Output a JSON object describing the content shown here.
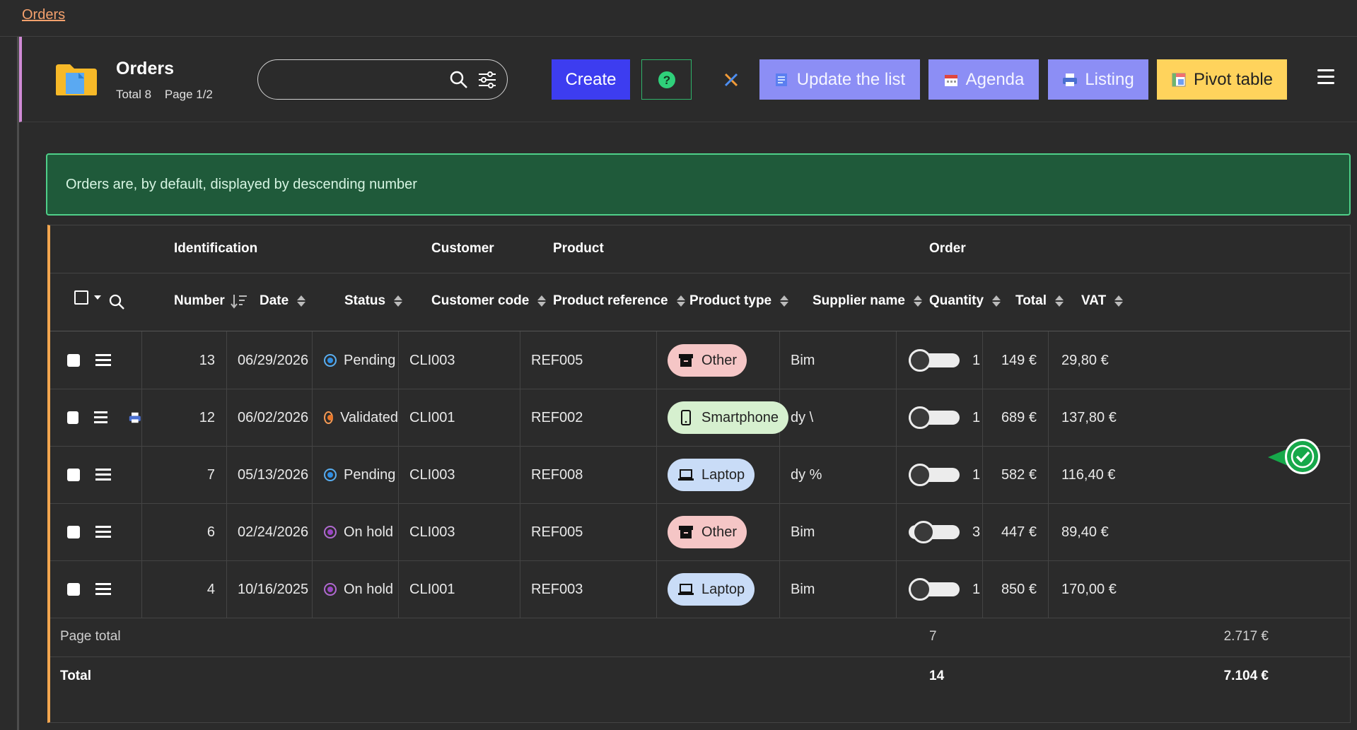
{
  "breadcrumb": "Orders",
  "header": {
    "title": "Orders",
    "total": "Total 8",
    "page": "Page 1/2"
  },
  "search": {
    "placeholder": "",
    "value": ""
  },
  "toolbar": {
    "create": "Create",
    "update": "Update the list",
    "agenda": "Agenda",
    "listing": "Listing",
    "pivot": "Pivot table"
  },
  "alert": "Orders are, by default, displayed by descending number",
  "table": {
    "groups": {
      "identification": "Identification",
      "customer": "Customer",
      "product": "Product",
      "order": "Order"
    },
    "columns": {
      "number": "Number",
      "date": "Date",
      "status": "Status",
      "customer_code": "Customer code",
      "product_reference": "Product reference",
      "product_type": "Product type",
      "supplier_name": "Supplier name",
      "quantity": "Quantity",
      "total": "Total",
      "vat": "VAT"
    },
    "rows": [
      {
        "number": "13",
        "date": "06/29/2026",
        "status": "Pending",
        "customer_code": "CLI003",
        "product_reference": "REF005",
        "product_type": "Other",
        "supplier": "Bim",
        "quantity": "1",
        "total": "149 €",
        "vat": "29,80 €",
        "toggle": 0.0
      },
      {
        "number": "12",
        "date": "06/02/2026",
        "status": "Validated",
        "customer_code": "CLI001",
        "product_reference": "REF002",
        "product_type": "Smartphone",
        "supplier": "dy \\",
        "quantity": "1",
        "total": "689 €",
        "vat": "137,80 €",
        "toggle": 0.0
      },
      {
        "number": "7",
        "date": "05/13/2026",
        "status": "Pending",
        "customer_code": "CLI003",
        "product_reference": "REF008",
        "product_type": "Laptop",
        "supplier": "dy %",
        "quantity": "1",
        "total": "582 €",
        "vat": "116,40 €",
        "toggle": 0.0
      },
      {
        "number": "6",
        "date": "02/24/2026",
        "status": "On hold",
        "customer_code": "CLI003",
        "product_reference": "REF005",
        "product_type": "Other",
        "supplier": "Bim",
        "quantity": "3",
        "total": "447 €",
        "vat": "89,40 €",
        "toggle": 0.12
      },
      {
        "number": "4",
        "date": "10/16/2025",
        "status": "On hold",
        "customer_code": "CLI001",
        "product_reference": "REF003",
        "product_type": "Laptop",
        "supplier": "Bim",
        "quantity": "1",
        "total": "850 €",
        "vat": "170,00 €",
        "toggle": 0.0
      }
    ],
    "page_total": {
      "label": "Page total",
      "quantity": "7",
      "total": "2.717 €"
    },
    "grand_total": {
      "label": "Total",
      "quantity": "14",
      "total": "7.104 €"
    }
  },
  "colors": {
    "accent_create": "#3d3df0",
    "accent_secondary": "#8c8ef5",
    "pivot": "#ffd35c",
    "alert_bg": "#1f5a3a",
    "status_pending": "#2f8ee3",
    "status_validated": "#e8772a",
    "status_onhold": "#9a46c4"
  }
}
